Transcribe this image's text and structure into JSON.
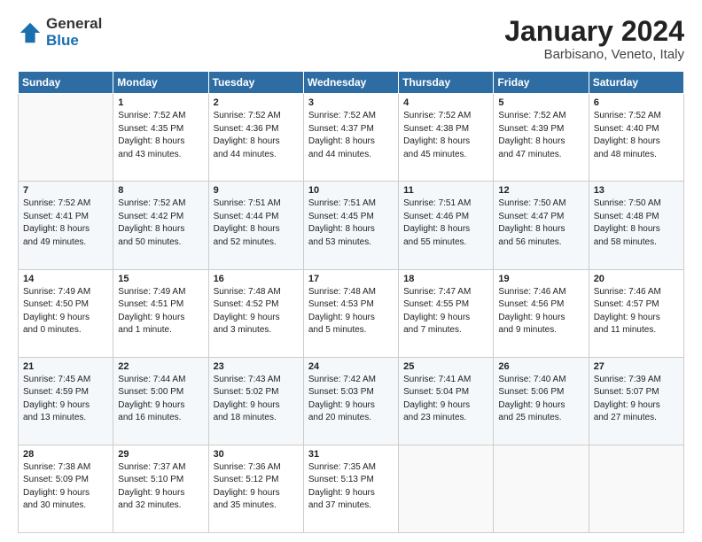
{
  "header": {
    "logo_general": "General",
    "logo_blue": "Blue",
    "title": "January 2024",
    "subtitle": "Barbisano, Veneto, Italy"
  },
  "columns": [
    "Sunday",
    "Monday",
    "Tuesday",
    "Wednesday",
    "Thursday",
    "Friday",
    "Saturday"
  ],
  "weeks": [
    [
      {
        "day": "",
        "info": ""
      },
      {
        "day": "1",
        "info": "Sunrise: 7:52 AM\nSunset: 4:35 PM\nDaylight: 8 hours\nand 43 minutes."
      },
      {
        "day": "2",
        "info": "Sunrise: 7:52 AM\nSunset: 4:36 PM\nDaylight: 8 hours\nand 44 minutes."
      },
      {
        "day": "3",
        "info": "Sunrise: 7:52 AM\nSunset: 4:37 PM\nDaylight: 8 hours\nand 44 minutes."
      },
      {
        "day": "4",
        "info": "Sunrise: 7:52 AM\nSunset: 4:38 PM\nDaylight: 8 hours\nand 45 minutes."
      },
      {
        "day": "5",
        "info": "Sunrise: 7:52 AM\nSunset: 4:39 PM\nDaylight: 8 hours\nand 47 minutes."
      },
      {
        "day": "6",
        "info": "Sunrise: 7:52 AM\nSunset: 4:40 PM\nDaylight: 8 hours\nand 48 minutes."
      }
    ],
    [
      {
        "day": "7",
        "info": "Sunrise: 7:52 AM\nSunset: 4:41 PM\nDaylight: 8 hours\nand 49 minutes."
      },
      {
        "day": "8",
        "info": "Sunrise: 7:52 AM\nSunset: 4:42 PM\nDaylight: 8 hours\nand 50 minutes."
      },
      {
        "day": "9",
        "info": "Sunrise: 7:51 AM\nSunset: 4:44 PM\nDaylight: 8 hours\nand 52 minutes."
      },
      {
        "day": "10",
        "info": "Sunrise: 7:51 AM\nSunset: 4:45 PM\nDaylight: 8 hours\nand 53 minutes."
      },
      {
        "day": "11",
        "info": "Sunrise: 7:51 AM\nSunset: 4:46 PM\nDaylight: 8 hours\nand 55 minutes."
      },
      {
        "day": "12",
        "info": "Sunrise: 7:50 AM\nSunset: 4:47 PM\nDaylight: 8 hours\nand 56 minutes."
      },
      {
        "day": "13",
        "info": "Sunrise: 7:50 AM\nSunset: 4:48 PM\nDaylight: 8 hours\nand 58 minutes."
      }
    ],
    [
      {
        "day": "14",
        "info": "Sunrise: 7:49 AM\nSunset: 4:50 PM\nDaylight: 9 hours\nand 0 minutes."
      },
      {
        "day": "15",
        "info": "Sunrise: 7:49 AM\nSunset: 4:51 PM\nDaylight: 9 hours\nand 1 minute."
      },
      {
        "day": "16",
        "info": "Sunrise: 7:48 AM\nSunset: 4:52 PM\nDaylight: 9 hours\nand 3 minutes."
      },
      {
        "day": "17",
        "info": "Sunrise: 7:48 AM\nSunset: 4:53 PM\nDaylight: 9 hours\nand 5 minutes."
      },
      {
        "day": "18",
        "info": "Sunrise: 7:47 AM\nSunset: 4:55 PM\nDaylight: 9 hours\nand 7 minutes."
      },
      {
        "day": "19",
        "info": "Sunrise: 7:46 AM\nSunset: 4:56 PM\nDaylight: 9 hours\nand 9 minutes."
      },
      {
        "day": "20",
        "info": "Sunrise: 7:46 AM\nSunset: 4:57 PM\nDaylight: 9 hours\nand 11 minutes."
      }
    ],
    [
      {
        "day": "21",
        "info": "Sunrise: 7:45 AM\nSunset: 4:59 PM\nDaylight: 9 hours\nand 13 minutes."
      },
      {
        "day": "22",
        "info": "Sunrise: 7:44 AM\nSunset: 5:00 PM\nDaylight: 9 hours\nand 16 minutes."
      },
      {
        "day": "23",
        "info": "Sunrise: 7:43 AM\nSunset: 5:02 PM\nDaylight: 9 hours\nand 18 minutes."
      },
      {
        "day": "24",
        "info": "Sunrise: 7:42 AM\nSunset: 5:03 PM\nDaylight: 9 hours\nand 20 minutes."
      },
      {
        "day": "25",
        "info": "Sunrise: 7:41 AM\nSunset: 5:04 PM\nDaylight: 9 hours\nand 23 minutes."
      },
      {
        "day": "26",
        "info": "Sunrise: 7:40 AM\nSunset: 5:06 PM\nDaylight: 9 hours\nand 25 minutes."
      },
      {
        "day": "27",
        "info": "Sunrise: 7:39 AM\nSunset: 5:07 PM\nDaylight: 9 hours\nand 27 minutes."
      }
    ],
    [
      {
        "day": "28",
        "info": "Sunrise: 7:38 AM\nSunset: 5:09 PM\nDaylight: 9 hours\nand 30 minutes."
      },
      {
        "day": "29",
        "info": "Sunrise: 7:37 AM\nSunset: 5:10 PM\nDaylight: 9 hours\nand 32 minutes."
      },
      {
        "day": "30",
        "info": "Sunrise: 7:36 AM\nSunset: 5:12 PM\nDaylight: 9 hours\nand 35 minutes."
      },
      {
        "day": "31",
        "info": "Sunrise: 7:35 AM\nSunset: 5:13 PM\nDaylight: 9 hours\nand 37 minutes."
      },
      {
        "day": "",
        "info": ""
      },
      {
        "day": "",
        "info": ""
      },
      {
        "day": "",
        "info": ""
      }
    ]
  ]
}
